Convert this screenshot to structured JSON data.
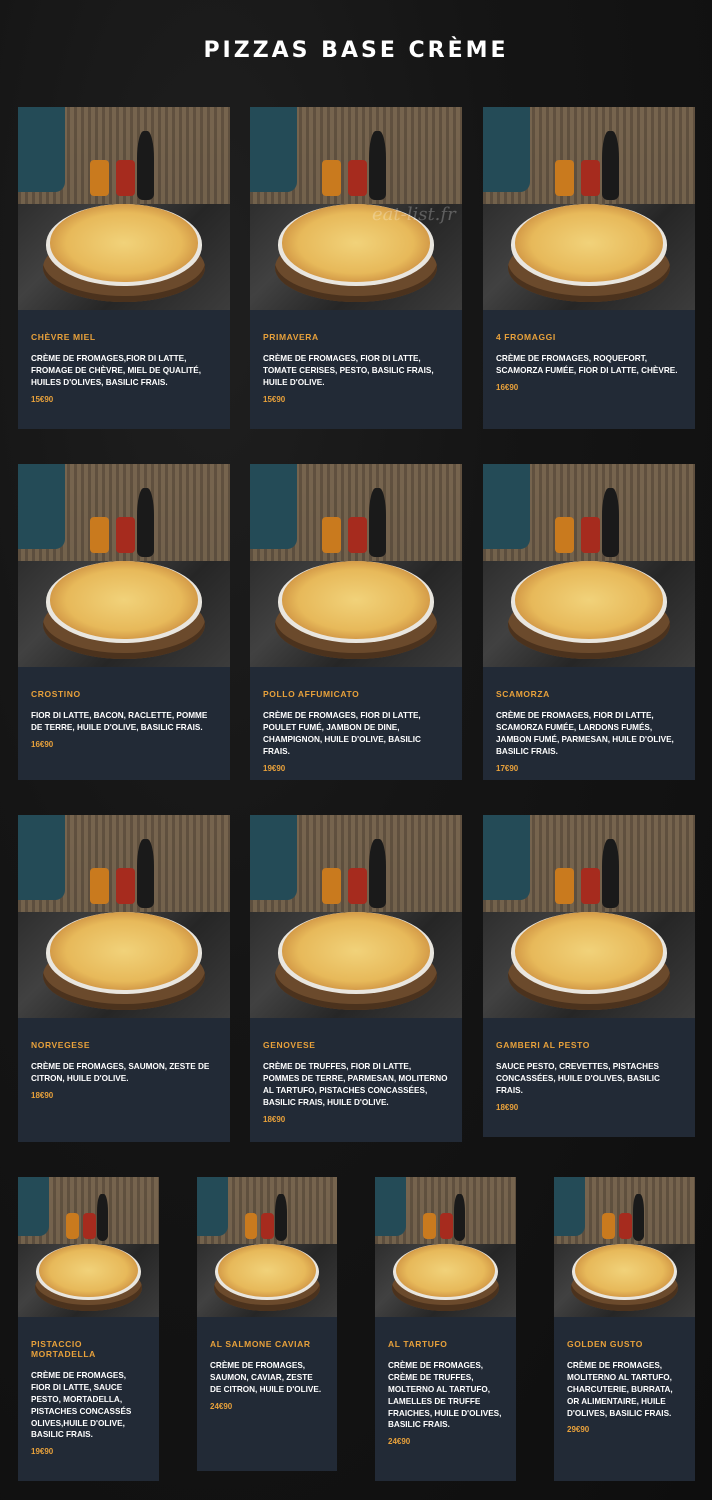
{
  "page": {
    "title": "PIZZAS BASE CRÈME",
    "watermark": "eat-list.fr"
  },
  "pizzas": [
    {
      "name": "CHÈVRE MIEL",
      "description": "CRÈME DE FROMAGES,FIOR DI LATTE, FROMAGE DE CHÈVRE, MIEL DE QUALITÉ, HUILES D'OLIVES, BASILIC FRAIS.",
      "price": "15€90"
    },
    {
      "name": "PRIMAVERA",
      "description": "CRÈME DE FROMAGES, FIOR DI LATTE, TOMATE CERISES, PESTO, BASILIC FRAIS, HUILE D'OLIVE.",
      "price": "15€90"
    },
    {
      "name": "4 FROMAGGI",
      "description": "CRÈME DE FROMAGES, ROQUEFORT, SCAMORZA FUMÉE, FIOR DI LATTE, CHÈVRE.",
      "price": "16€90"
    },
    {
      "name": "CROSTINO",
      "description": "FIOR DI LATTE, BACON, RACLETTE, POMME DE TERRE, HUILE D'OLIVE, BASILIC FRAIS.",
      "price": "16€90"
    },
    {
      "name": "POLLO AFFUMICATO",
      "description": "CRÈME DE FROMAGES, FIOR DI LATTE, POULET FUMÉ, JAMBON DE DINE, CHAMPIGNON, HUILE D'OLIVE, BASILIC FRAIS.",
      "price": "19€90"
    },
    {
      "name": "SCAMORZA",
      "description": "CRÈME DE FROMAGES, FIOR DI LATTE, SCAMORZA FUMÉE, LARDONS FUMÉS, JAMBON FUMÉ, PARMESAN, HUILE D'OLIVE, BASILIC FRAIS.",
      "price": "17€90"
    },
    {
      "name": "NORVEGESE",
      "description": "CRÈME DE FROMAGES, SAUMON, ZESTE DE CITRON, HUILE D'OLIVE.",
      "price": "18€90"
    },
    {
      "name": "GENOVESE",
      "description": "CRÈME DE TRUFFES, FIOR DI LATTE, POMMES DE TERRE, PARMESAN, MOLITERNO AL TARTUFO, PISTACHES CONCASSÉES, BASILIC FRAIS, HUILE D'OLIVE.",
      "price": "18€90"
    },
    {
      "name": "GAMBERI AL PESTO",
      "description": "SAUCE PESTO, CREVETTES, PISTACHES CONCASSÉES, HUILE D'OLIVES, BASILIC FRAIS.",
      "price": "18€90"
    },
    {
      "name": "PISTACCIO MORTADELLA",
      "description": "CRÈME DE FROMAGES, FIOR DI LATTE, SAUCE PESTO, MORTADELLA, PISTACHES CONCASSÉS OLIVES,HUILE D'OLIVE, BASILIC FRAIS.",
      "price": "19€90"
    },
    {
      "name": "AL SALMONE CAVIAR",
      "description": "CRÈME DE FROMAGES, SAUMON, CAVIAR, ZESTE DE CITRON, HUILE D'OLIVE.",
      "price": "24€90"
    },
    {
      "name": "AL TARTUFO",
      "description": "CRÈME DE FROMAGES, CRÈME DE TRUFFES, MOLTERNO AL TARTUFO, LAMELLES DE TRUFFE FRAICHES, HUILE D'OLIVES, BASILIC FRAIS.",
      "price": "24€90"
    },
    {
      "name": "GOLDEN GUSTO",
      "description": "CRÈME DE FROMAGES, MOLITERNO AL TARTUFO, CHARCUTERIE, BURRATA, OR ALIMENTAIRE, HUILE D'OLIVES, BASILIC FRAIS.",
      "price": "29€90"
    }
  ]
}
